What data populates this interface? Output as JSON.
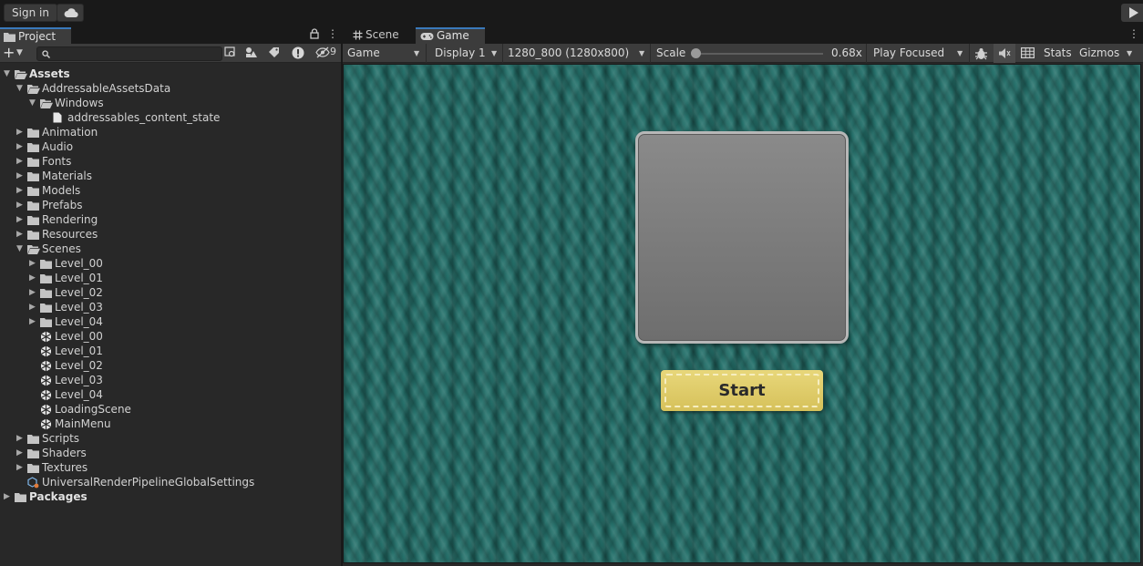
{
  "topbar": {
    "sign_in": "Sign in"
  },
  "project": {
    "tab_label": "Project",
    "hidden_count": "9",
    "tree": [
      {
        "label": "Assets",
        "depth": 0,
        "expand": "open",
        "kind": "folder-open",
        "bold": true
      },
      {
        "label": "AddressableAssetsData",
        "depth": 1,
        "expand": "open",
        "kind": "folder-open"
      },
      {
        "label": "Windows",
        "depth": 2,
        "expand": "open",
        "kind": "folder-open"
      },
      {
        "label": "addressables_content_state",
        "depth": 3,
        "expand": "none",
        "kind": "file"
      },
      {
        "label": "Animation",
        "depth": 1,
        "expand": "closed",
        "kind": "folder"
      },
      {
        "label": "Audio",
        "depth": 1,
        "expand": "closed",
        "kind": "folder"
      },
      {
        "label": "Fonts",
        "depth": 1,
        "expand": "closed",
        "kind": "folder"
      },
      {
        "label": "Materials",
        "depth": 1,
        "expand": "closed",
        "kind": "folder"
      },
      {
        "label": "Models",
        "depth": 1,
        "expand": "closed",
        "kind": "folder"
      },
      {
        "label": "Prefabs",
        "depth": 1,
        "expand": "closed",
        "kind": "folder"
      },
      {
        "label": "Rendering",
        "depth": 1,
        "expand": "closed",
        "kind": "folder"
      },
      {
        "label": "Resources",
        "depth": 1,
        "expand": "closed",
        "kind": "folder"
      },
      {
        "label": "Scenes",
        "depth": 1,
        "expand": "open",
        "kind": "folder-open"
      },
      {
        "label": "Level_00",
        "depth": 2,
        "expand": "closed",
        "kind": "folder"
      },
      {
        "label": "Level_01",
        "depth": 2,
        "expand": "closed",
        "kind": "folder"
      },
      {
        "label": "Level_02",
        "depth": 2,
        "expand": "closed",
        "kind": "folder"
      },
      {
        "label": "Level_03",
        "depth": 2,
        "expand": "closed",
        "kind": "folder"
      },
      {
        "label": "Level_04",
        "depth": 2,
        "expand": "closed",
        "kind": "folder"
      },
      {
        "label": "Level_00",
        "depth": 2,
        "expand": "none",
        "kind": "scene"
      },
      {
        "label": "Level_01",
        "depth": 2,
        "expand": "none",
        "kind": "scene"
      },
      {
        "label": "Level_02",
        "depth": 2,
        "expand": "none",
        "kind": "scene"
      },
      {
        "label": "Level_03",
        "depth": 2,
        "expand": "none",
        "kind": "scene"
      },
      {
        "label": "Level_04",
        "depth": 2,
        "expand": "none",
        "kind": "scene"
      },
      {
        "label": "LoadingScene",
        "depth": 2,
        "expand": "none",
        "kind": "scene"
      },
      {
        "label": "MainMenu",
        "depth": 2,
        "expand": "none",
        "kind": "scene"
      },
      {
        "label": "Scripts",
        "depth": 1,
        "expand": "closed",
        "kind": "folder"
      },
      {
        "label": "Shaders",
        "depth": 1,
        "expand": "closed",
        "kind": "folder"
      },
      {
        "label": "Textures",
        "depth": 1,
        "expand": "closed",
        "kind": "folder"
      },
      {
        "label": "UniversalRenderPipelineGlobalSettings",
        "depth": 1,
        "expand": "none",
        "kind": "asset"
      },
      {
        "label": "Packages",
        "depth": 0,
        "expand": "closed",
        "kind": "folder",
        "bold": true
      }
    ]
  },
  "gameview": {
    "tabs": [
      {
        "label": "Scene"
      },
      {
        "label": "Game"
      }
    ],
    "toolbar": {
      "view_mode": "Game",
      "display": "Display 1",
      "resolution": "1280_800 (1280x800)",
      "scale_label": "Scale",
      "scale_value": "0.68x",
      "scale_level": 0.68,
      "play_mode": "Play Focused",
      "stats": "Stats",
      "gizmos": "Gizmos"
    },
    "game": {
      "start_label": "Start"
    },
    "colors": {
      "felt": "#24706a",
      "button": "#e0cc68",
      "card": "#7c7c7c",
      "accent": "#3a79bb"
    }
  }
}
